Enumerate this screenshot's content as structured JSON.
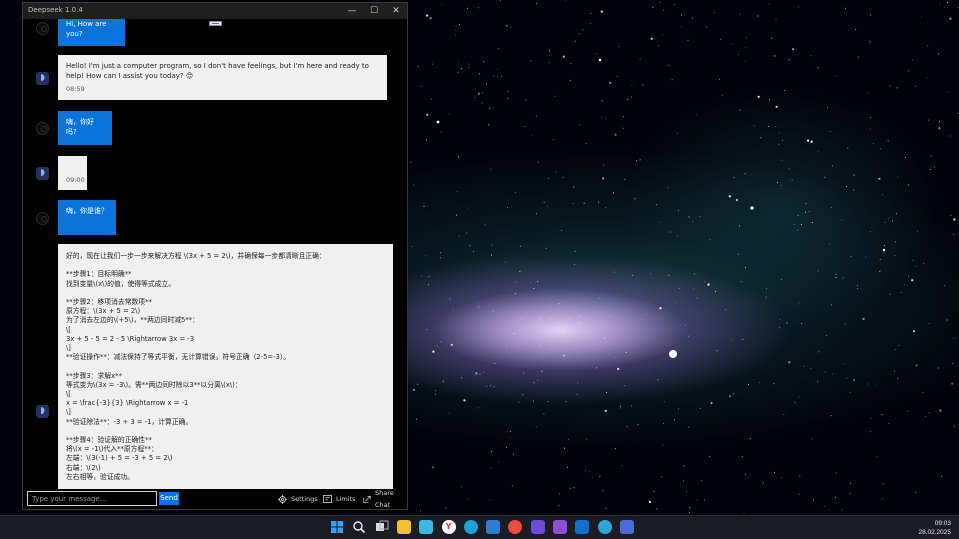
{
  "app": {
    "title": "Deepseek 1.0.4",
    "controls": {
      "minimize": "—",
      "maximize": "☐",
      "close": "✕"
    }
  },
  "messages": [
    {
      "role": "user",
      "text": "Hi, How are you?",
      "time": ""
    },
    {
      "role": "bot",
      "text": "Hello! I'm just a computer program, so I don't have feelings, but I'm here and ready to help! How can I assist you today? 😊",
      "time": "08:59"
    },
    {
      "role": "user",
      "text": "嗨，你好吗?",
      "time": ""
    },
    {
      "role": "bot",
      "text": "",
      "time": "09:00"
    },
    {
      "role": "user",
      "text": "嗨，你是谁？",
      "time": ""
    },
    {
      "role": "bot",
      "text": "好的，现在让我们一步一步来解决方程 \\(3x + 5 = 2\\)，并确保每一步都清晰且正确：\n\n**步骤1：目标明确**\n找到变量\\(x\\)的值，使得等式成立。\n\n**步骤2：移项消去常数项**\n原方程：\\(3x + 5 = 2\\)\n为了消去左边的\\(+5\\)，**两边同时减5**：\n\\[\n3x + 5 - 5 = 2 - 5 \\Rightarrow 3x = -3\n\\]\n**验证操作**：减法保持了等式平衡，无计算错误，符号正确（2-5=-3）。\n\n**步骤3：求解x**\n等式变为\\(3x = -3\\)。需**两边同时除以3**以分离\\(x\\)：\n\\[\nx = \\frac{-3}{3} \\Rightarrow x = -1\n\\]\n**验证除法**：-3 ÷ 3 = -1，计算正确。\n\n**步骤4：验证解的正确性**\n将\\(x = -1\\)代入**原方程**：\n左端：\\(3(-1) + 5 = -3 + 5 = 2\\)\n右端：\\(2\\)\n左右相等，验证成功。",
      "time": ""
    }
  ],
  "input": {
    "placeholder": "Type your message...",
    "send_label": "Send"
  },
  "toolbar": {
    "settings_label": "Settings",
    "settings_icon": "gear-icon",
    "limits_label": "Limits",
    "limits_icon": "limits-icon",
    "share_label": "Share Chat",
    "share_icon": "share-icon"
  },
  "taskbar": {
    "apps": [
      {
        "name": "start-icon",
        "glyph": "",
        "color": "#3aa0ff"
      },
      {
        "name": "search-icon",
        "glyph": "",
        "color": ""
      },
      {
        "name": "task-view-icon",
        "glyph": "",
        "color": ""
      },
      {
        "name": "file-explorer-icon",
        "glyph": "",
        "color": "#f2c12e"
      },
      {
        "name": "notepad-icon",
        "glyph": "",
        "color": "#3fb6e0"
      },
      {
        "name": "yandex-browser-icon",
        "glyph": "Y",
        "color": "#ffffff"
      },
      {
        "name": "edge-icon",
        "glyph": "",
        "color": "#1fa1d6"
      },
      {
        "name": "app-icon",
        "glyph": "",
        "color": "#2d7dd2"
      },
      {
        "name": "chrome-icon",
        "glyph": "",
        "color": "#e74c3c"
      },
      {
        "name": "save-app-icon",
        "glyph": "",
        "color": "#6b4bd8"
      },
      {
        "name": "visual-studio-icon",
        "glyph": "",
        "color": "#8e4fd6"
      },
      {
        "name": "outlook-icon",
        "glyph": "",
        "color": "#1170c8"
      },
      {
        "name": "telegram-icon",
        "glyph": "",
        "color": "#2ea6da"
      },
      {
        "name": "deepseek-icon",
        "glyph": "",
        "color": "#4b6cd8"
      }
    ],
    "clock_time": "09:03",
    "clock_date": "28.02.2025"
  }
}
